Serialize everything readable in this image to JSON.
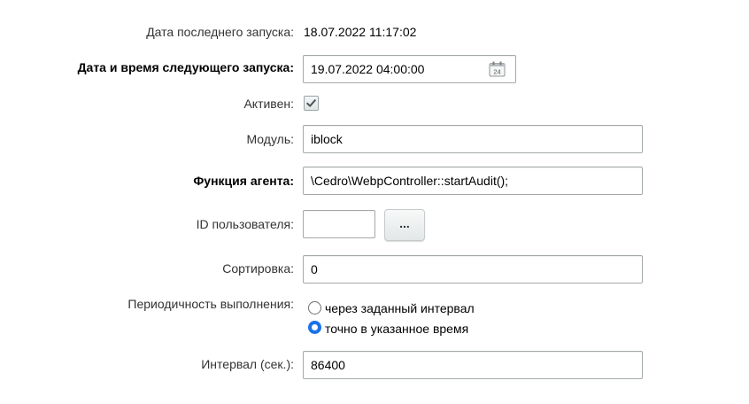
{
  "last_run": {
    "label": "Дата последнего запуска:",
    "value": "18.07.2022 11:17:02"
  },
  "next_run": {
    "label": "Дата и время следующего запуска:",
    "value": "19.07.2022 04:00:00",
    "icon": "calendar-icon",
    "calendar_day": "24"
  },
  "active": {
    "label": "Активен:",
    "checked": true
  },
  "module": {
    "label": "Модуль:",
    "value": "iblock"
  },
  "agent_function": {
    "label": "Функция агента:",
    "value": "\\Cedro\\WebpController::startAudit();"
  },
  "user_id": {
    "label": "ID пользователя:",
    "value": "",
    "button_label": "..."
  },
  "sort": {
    "label": "Сортировка:",
    "value": "0"
  },
  "periodicity": {
    "label": "Периодичность выполнения:",
    "options": [
      {
        "label": "через заданный интервал",
        "checked": false
      },
      {
        "label": "точно в указанное время",
        "checked": true
      }
    ]
  },
  "interval": {
    "label": "Интервал (сек.):",
    "value": "86400"
  },
  "colors": {
    "accent": "#1a73e8",
    "border": "#a3a9ab",
    "text": "#333333"
  }
}
